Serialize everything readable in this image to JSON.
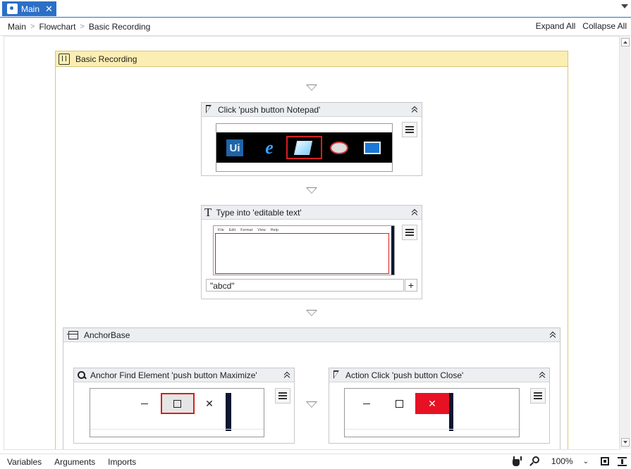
{
  "tabs": [
    {
      "label": "Main"
    }
  ],
  "breadcrumb": [
    "Main",
    "Flowchart",
    "Basic Recording"
  ],
  "toolbar": {
    "expand_all": "Expand All",
    "collapse_all": "Collapse All"
  },
  "sequence": {
    "title": "Basic Recording"
  },
  "activities": {
    "click_notepad": {
      "title": "Click 'push button  Notepad'"
    },
    "type_into": {
      "title": "Type into 'editable text'",
      "text_value": "\"abcd\"",
      "notepad_menu": [
        "File",
        "Edit",
        "Format",
        "View",
        "Help"
      ]
    },
    "anchor_base": {
      "title": "AnchorBase"
    },
    "anchor_find": {
      "title": "Anchor Find Element 'push button  Maximize'"
    },
    "action_click": {
      "title": "Action Click 'push button  Close'"
    }
  },
  "thumbnail": {
    "uipath_icon_text": "Ui"
  },
  "bottom": {
    "tabs": [
      "Variables",
      "Arguments",
      "Imports"
    ],
    "zoom": "100%"
  },
  "colors": {
    "accent": "#2b6fc7",
    "sequence_header": "#fbeeb2",
    "selection": "#d61f1f",
    "close_button": "#e81123"
  }
}
